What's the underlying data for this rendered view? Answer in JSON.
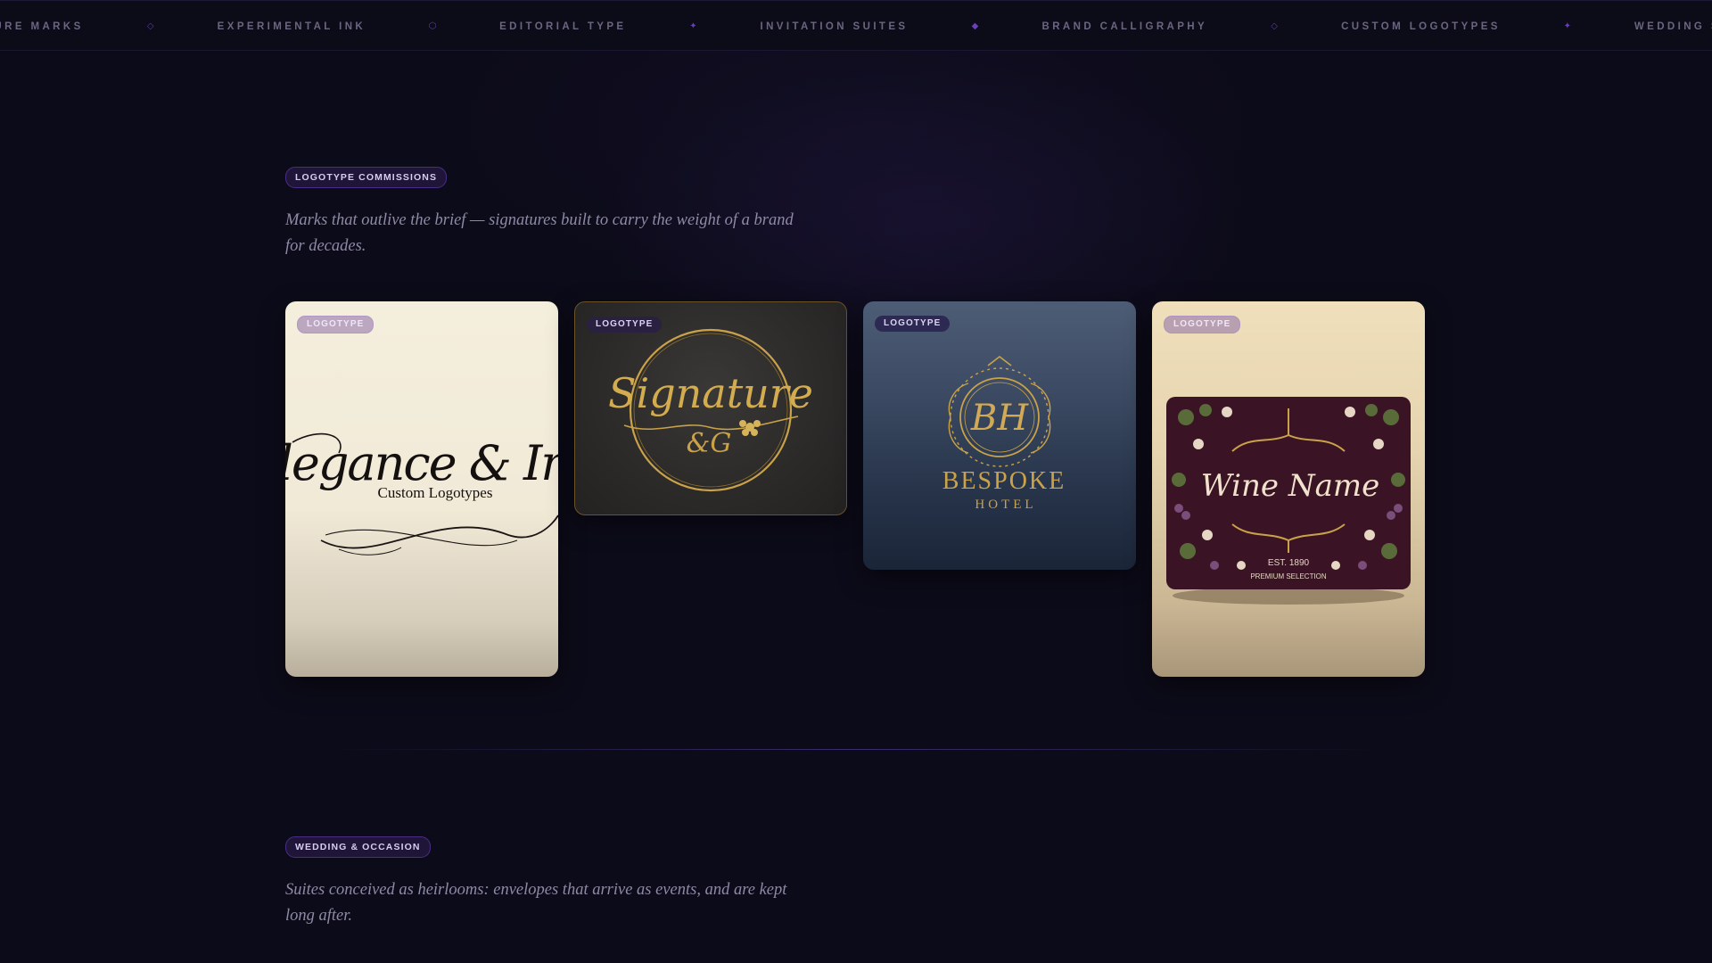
{
  "marquee": {
    "items": [
      "ture marks",
      "experimental ink",
      "editorial type",
      "invitation suites",
      "brand calligraphy",
      "custom logotypes",
      "wedding suites"
    ]
  },
  "logotype_section": {
    "badge": "LOGOTYPE COMMISSIONS",
    "lede": "Marks that outlive the brief — signatures built to carry the weight of a brand for decades.",
    "cards": [
      {
        "tag": "LOGOTYPE",
        "art": {
          "script": "Elegance & Ink",
          "subtitle": "Custom Logotypes"
        }
      },
      {
        "tag": "LOGOTYPE",
        "art": {
          "script": "Signature",
          "monogram": "&G"
        }
      },
      {
        "tag": "LOGOTYPE",
        "art": {
          "monogram": "BH",
          "name": "BESPOKE",
          "subtitle": "HOTEL"
        }
      },
      {
        "tag": "LOGOTYPE",
        "art": {
          "script": "Wine Name",
          "est": "EST. 1890",
          "subtitle": "PREMIUM SELECTION"
        }
      }
    ]
  },
  "wedding_section": {
    "badge": "WEDDING & OCCASION",
    "lede": "Suites conceived as heirlooms: envelopes that arrive as events, and are kept long after."
  },
  "colors": {
    "background": "#0c0b19",
    "accent": "#6d3cc4",
    "gold": "#c9a24a"
  }
}
